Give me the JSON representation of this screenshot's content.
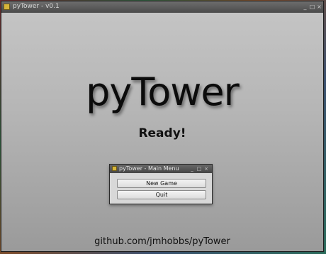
{
  "window": {
    "title": "pyTower - v0.1",
    "icon": "app-icon",
    "controls": {
      "minimize": "_",
      "maximize": "□",
      "close": "×"
    }
  },
  "main": {
    "logo": "pyTower",
    "status": "Ready!",
    "footer": "github.com/jmhobbs/pyTower"
  },
  "menu_dialog": {
    "title": "pyTower - Main Menu",
    "controls": {
      "minimize": "_",
      "maximize": "□",
      "close": "×"
    },
    "buttons": [
      {
        "label": "New Game"
      },
      {
        "label": "Quit"
      }
    ]
  },
  "colors": {
    "title_bar": "#4a4a4a",
    "content_top": "#c4c4c4",
    "content_bottom": "#9a9a9a",
    "dialog_bg": "#d8d8d8",
    "text": "#111111"
  }
}
